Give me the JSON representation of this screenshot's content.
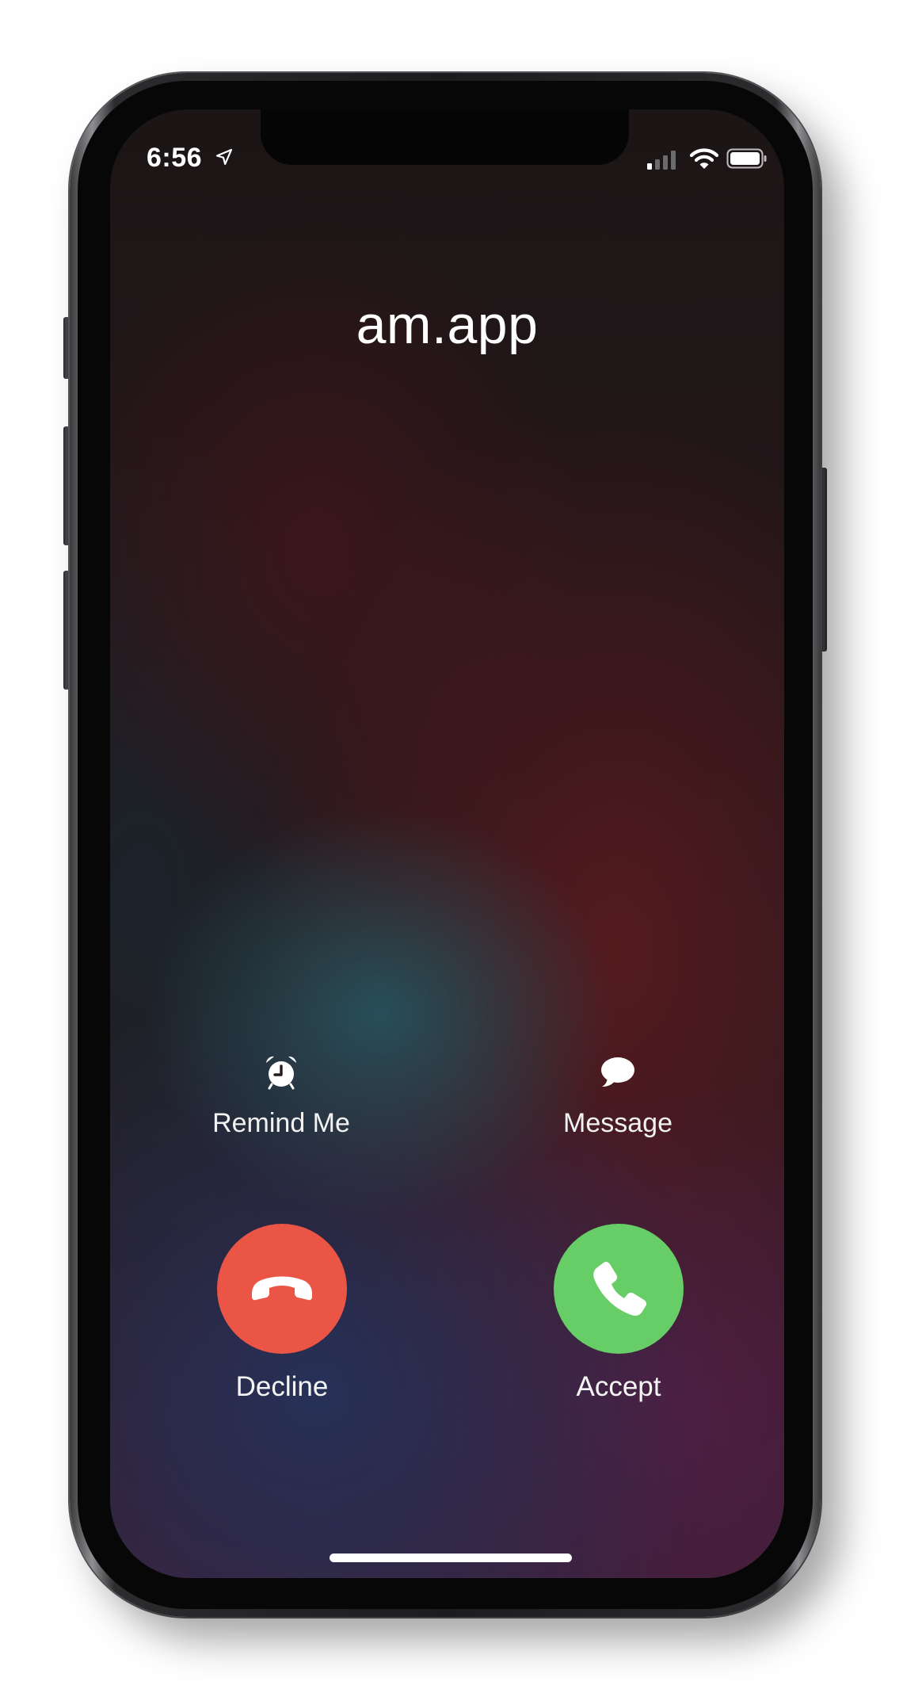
{
  "status_bar": {
    "time": "6:56",
    "location_icon": "location-arrow-icon",
    "signal_icon": "cellular-signal-icon",
    "wifi_icon": "wifi-icon",
    "battery_icon": "battery-full-icon"
  },
  "call": {
    "caller_name": "am.app"
  },
  "actions": {
    "remind": {
      "label": "Remind Me",
      "icon": "alarm-clock-icon"
    },
    "message": {
      "label": "Message",
      "icon": "speech-bubble-icon"
    },
    "decline": {
      "label": "Decline",
      "icon": "phone-hangup-icon",
      "color": "#eb5545"
    },
    "accept": {
      "label": "Accept",
      "icon": "phone-icon",
      "color": "#67ce67"
    }
  }
}
